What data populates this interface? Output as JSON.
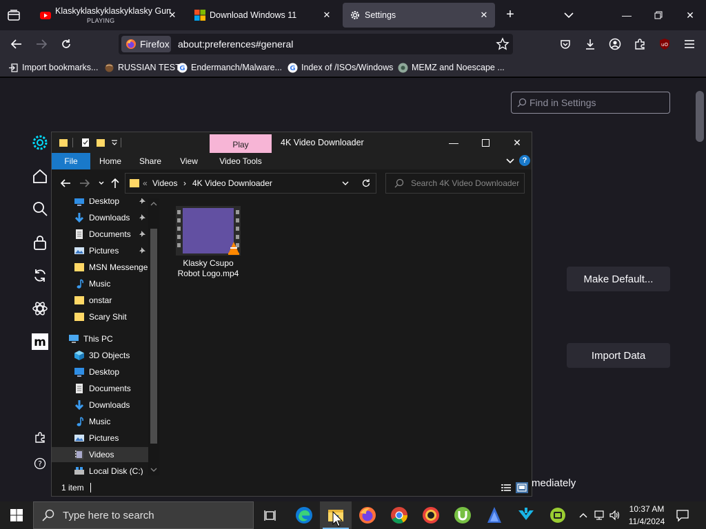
{
  "browser": {
    "tabs": [
      {
        "title": "Klaskyklaskyklaskyklasky Gumm",
        "subtitle": "PLAYING",
        "favicon": "youtube-icon"
      },
      {
        "title": "Download Windows 11",
        "favicon": "microsoft-icon"
      },
      {
        "title": "Settings",
        "favicon": "gear-icon"
      }
    ],
    "identity_label": "Firefox",
    "url": "about:preferences#general",
    "bookmarks": [
      "Import bookmarks...",
      "RUSSIAN TEST",
      "Endermanch/Malware...",
      "Index of /ISOs/Windows",
      "MEMZ and Noescape ..."
    ]
  },
  "preferences": {
    "search_placeholder": "Find in Settings",
    "make_default_label": "Make Default...",
    "import_data_label": "Import Data",
    "partial_text": "mediately"
  },
  "explorer": {
    "contextual_tab": "Play",
    "title": "4K Video Downloader",
    "ribbon_tabs": [
      "File",
      "Home",
      "Share",
      "View",
      "Video Tools"
    ],
    "breadcrumb": [
      "Videos",
      "4K Video Downloader"
    ],
    "breadcrumb_prefix": "«",
    "search_placeholder": "Search 4K Video Downloader",
    "nav_items": [
      {
        "label": "Desktop",
        "icon": "desktop-icon",
        "pinned": true
      },
      {
        "label": "Downloads",
        "icon": "download-arrow-icon",
        "pinned": true
      },
      {
        "label": "Documents",
        "icon": "documents-icon",
        "pinned": true
      },
      {
        "label": "Pictures",
        "icon": "pictures-icon",
        "pinned": true
      },
      {
        "label": "MSN Messenger",
        "icon": "folder-icon",
        "pinned": false
      },
      {
        "label": "Music",
        "icon": "music-icon",
        "pinned": false
      },
      {
        "label": "onstar",
        "icon": "folder-icon",
        "pinned": false
      },
      {
        "label": "Scary Shit",
        "icon": "folder-icon",
        "pinned": false
      },
      {
        "label": "This PC",
        "icon": "computer-icon",
        "pinned": false
      },
      {
        "label": "3D Objects",
        "icon": "cube-icon",
        "pinned": false
      },
      {
        "label": "Desktop",
        "icon": "desktop-icon",
        "pinned": false
      },
      {
        "label": "Documents",
        "icon": "documents-icon",
        "pinned": false
      },
      {
        "label": "Downloads",
        "icon": "download-arrow-icon",
        "pinned": false
      },
      {
        "label": "Music",
        "icon": "music-icon",
        "pinned": false
      },
      {
        "label": "Pictures",
        "icon": "pictures-icon",
        "pinned": false
      },
      {
        "label": "Videos",
        "icon": "videos-icon",
        "pinned": false,
        "selected": true
      },
      {
        "label": "Local Disk (C:)",
        "icon": "drive-icon",
        "pinned": false
      }
    ],
    "file": {
      "name_line1": "Klasky Csupo",
      "name_line2": "Robot Logo.mp4"
    },
    "status": "1 item"
  },
  "taskbar": {
    "search_placeholder": "Type here to search",
    "time": "10:37 AM",
    "date": "11/4/2024"
  },
  "colors": {
    "accent_blue": "#1979ca",
    "play_tab": "#f7b5d6",
    "firefox_bg": "#1c1b22",
    "explorer_bg": "#191919"
  }
}
